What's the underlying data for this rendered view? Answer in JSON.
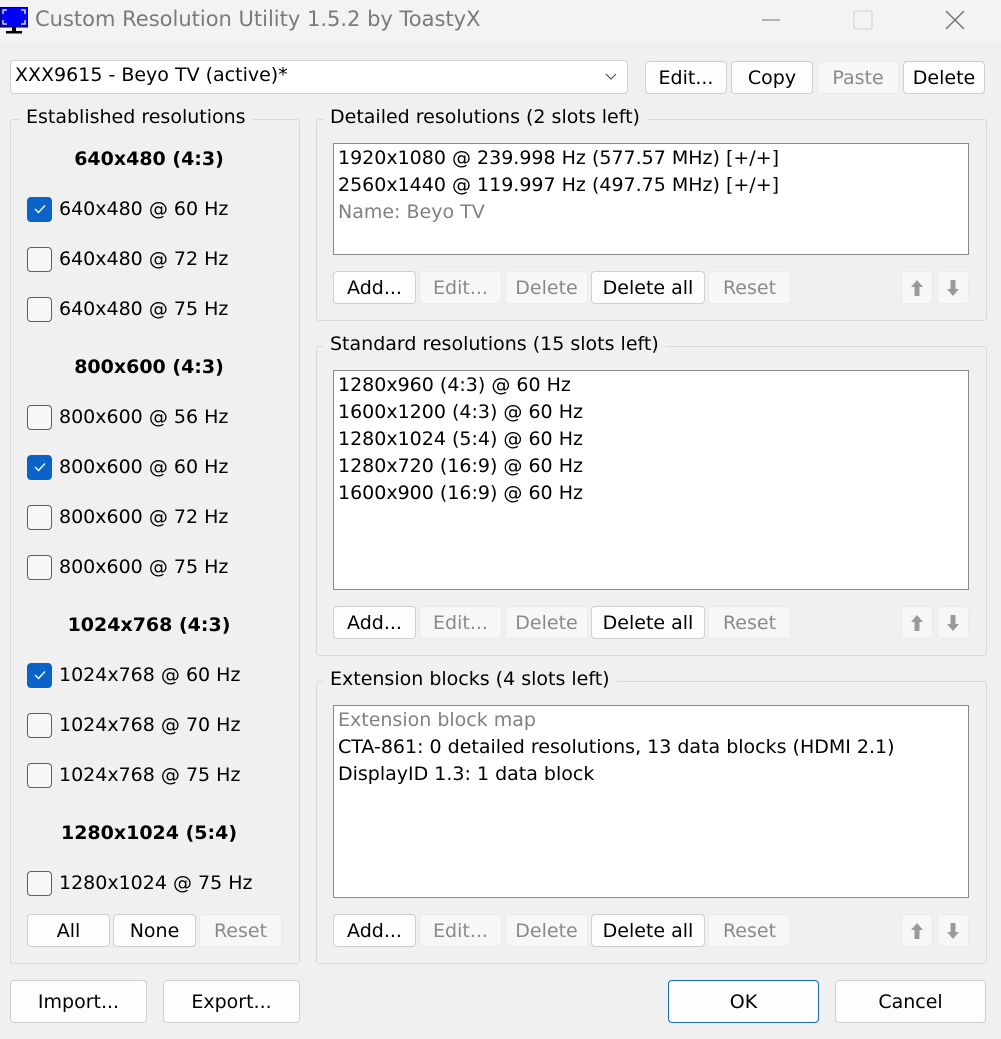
{
  "window": {
    "title": "Custom Resolution Utility 1.5.2 by ToastyX",
    "icon": "monitor-icon",
    "controls": [
      "minimize-icon",
      "maximize-icon",
      "close-icon"
    ]
  },
  "device": {
    "selected": "XXX9615 - Beyo TV (active)*",
    "buttons": {
      "edit": "Edit...",
      "copy": "Copy",
      "paste": "Paste",
      "delete": "Delete"
    },
    "paste_enabled": false
  },
  "established": {
    "title": "Established resolutions",
    "groups": [
      {
        "heading": "640x480 (4:3)",
        "items": [
          {
            "label": "640x480 @ 60 Hz",
            "checked": true
          },
          {
            "label": "640x480 @ 72 Hz",
            "checked": false
          },
          {
            "label": "640x480 @ 75 Hz",
            "checked": false
          }
        ]
      },
      {
        "heading": "800x600 (4:3)",
        "items": [
          {
            "label": "800x600 @ 56 Hz",
            "checked": false
          },
          {
            "label": "800x600 @ 60 Hz",
            "checked": true
          },
          {
            "label": "800x600 @ 72 Hz",
            "checked": false
          },
          {
            "label": "800x600 @ 75 Hz",
            "checked": false
          }
        ]
      },
      {
        "heading": "1024x768 (4:3)",
        "items": [
          {
            "label": "1024x768 @ 60 Hz",
            "checked": true
          },
          {
            "label": "1024x768 @ 70 Hz",
            "checked": false
          },
          {
            "label": "1024x768 @ 75 Hz",
            "checked": false
          }
        ]
      },
      {
        "heading": "1280x1024 (5:4)",
        "items": [
          {
            "label": "1280x1024 @ 75 Hz",
            "checked": false
          }
        ]
      }
    ],
    "buttons": {
      "all": "All",
      "none": "None",
      "reset": "Reset"
    }
  },
  "detailed": {
    "title": "Detailed resolutions (2 slots left)",
    "items": [
      {
        "text": "1920x1080 @ 239.998 Hz (577.57 MHz) [+/+]",
        "muted": false
      },
      {
        "text": "2560x1440 @ 119.997 Hz (497.75 MHz) [+/+]",
        "muted": false
      },
      {
        "text": "Name: Beyo TV",
        "muted": true
      }
    ]
  },
  "standard": {
    "title": "Standard resolutions (15 slots left)",
    "items": [
      {
        "text": "1280x960 (4:3) @ 60 Hz",
        "muted": false
      },
      {
        "text": "1600x1200 (4:3) @ 60 Hz",
        "muted": false
      },
      {
        "text": "1280x1024 (5:4) @ 60 Hz",
        "muted": false
      },
      {
        "text": "1280x720 (16:9) @ 60 Hz",
        "muted": false
      },
      {
        "text": "1600x900 (16:9) @ 60 Hz",
        "muted": false
      }
    ]
  },
  "extension": {
    "title": "Extension blocks (4 slots left)",
    "items": [
      {
        "text": "Extension block map",
        "muted": true
      },
      {
        "text": "CTA-861: 0 detailed resolutions, 13 data blocks (HDMI 2.1)",
        "muted": false
      },
      {
        "text": "DisplayID 1.3: 1 data block",
        "muted": false
      }
    ]
  },
  "list_buttons": {
    "add": "Add...",
    "edit": "Edit...",
    "delete": "Delete",
    "delete_all": "Delete all",
    "reset": "Reset",
    "up_icon": "arrow-up-icon",
    "down_icon": "arrow-down-icon"
  },
  "footer": {
    "import": "Import...",
    "export": "Export...",
    "ok": "OK",
    "cancel": "Cancel"
  },
  "colors": {
    "accent": "#0a63c9",
    "app_icon": "#0000ff",
    "window_bg": "#f0f0f0",
    "disabled_text": "#8a8a8a"
  }
}
